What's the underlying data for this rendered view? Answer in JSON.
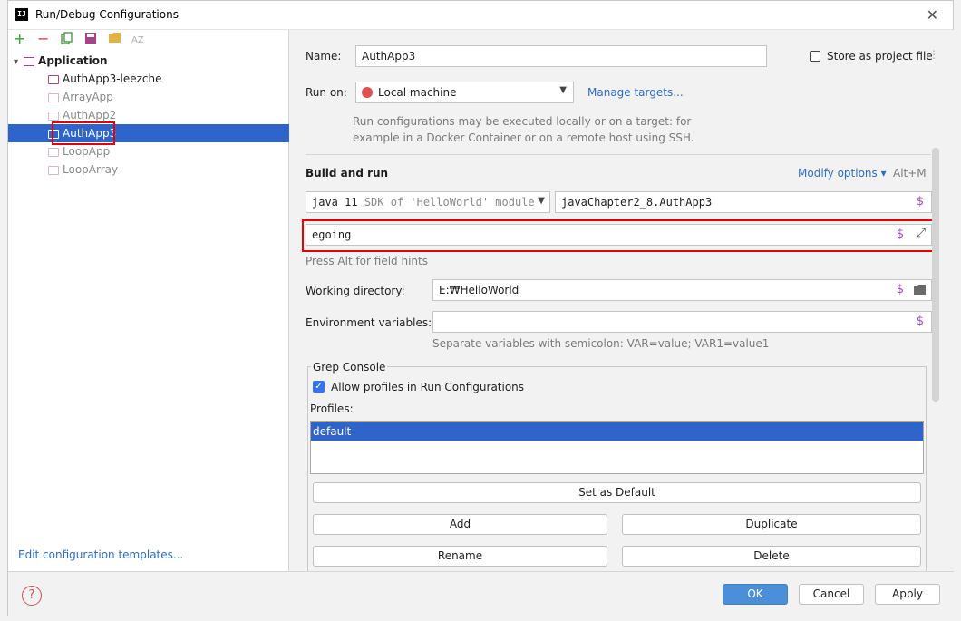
{
  "window": {
    "title": "Run/Debug Configurations",
    "logo": "IJ"
  },
  "toolbar": {
    "icons": [
      "add-icon",
      "remove-icon",
      "copy-icon",
      "save-icon",
      "folder-icon",
      "sort-icon"
    ]
  },
  "tree": {
    "root": "Application",
    "items": [
      {
        "label": "AuthApp3-leezche",
        "dim": false
      },
      {
        "label": "ArrayApp",
        "dim": true
      },
      {
        "label": "AuthApp2",
        "dim": true
      },
      {
        "label": "AuthApp3",
        "selected": true
      },
      {
        "label": "LoopApp",
        "dim": true
      },
      {
        "label": "LoopArray",
        "dim": true
      }
    ]
  },
  "left_footer": {
    "edit_templates": "Edit configuration templates..."
  },
  "form": {
    "name_label": "Name:",
    "name_value": "AuthApp3",
    "store_label": "Store as project file",
    "run_on_label": "Run on:",
    "run_on_value": "Local machine",
    "manage_targets": "Manage targets...",
    "run_on_hint_1": "Run configurations may be executed locally or on a target: for",
    "run_on_hint_2": "example in a Docker Container or on a remote host using SSH.",
    "build_and_run": "Build and run",
    "modify_options": "Modify options",
    "modify_shortcut": "Alt+M",
    "sdk_value": "java 11",
    "sdk_hint": "SDK of 'HelloWorld' module",
    "main_class": "javaChapter2_8.AuthApp3",
    "program_args": "egoing",
    "alt_hint": "Press Alt for field hints",
    "working_dir_label": "Working directory:",
    "working_dir_value": "E:₩HelloWorld",
    "env_label": "Environment variables:",
    "env_value": "",
    "env_hint": "Separate variables with semicolon: VAR=value; VAR1=value1"
  },
  "grep": {
    "title": "Grep Console",
    "allow_label": "Allow profiles in Run Configurations",
    "profiles_label": "Profiles:",
    "profiles": [
      "default"
    ],
    "set_default": "Set as Default",
    "add": "Add",
    "duplicate": "Duplicate",
    "rename": "Rename",
    "delete": "Delete"
  },
  "footer": {
    "ok": "OK",
    "cancel": "Cancel",
    "apply": "Apply"
  },
  "colors": {
    "accent": "#2e6ec2",
    "selection": "#2f65ca",
    "highlight": "#e50000"
  }
}
